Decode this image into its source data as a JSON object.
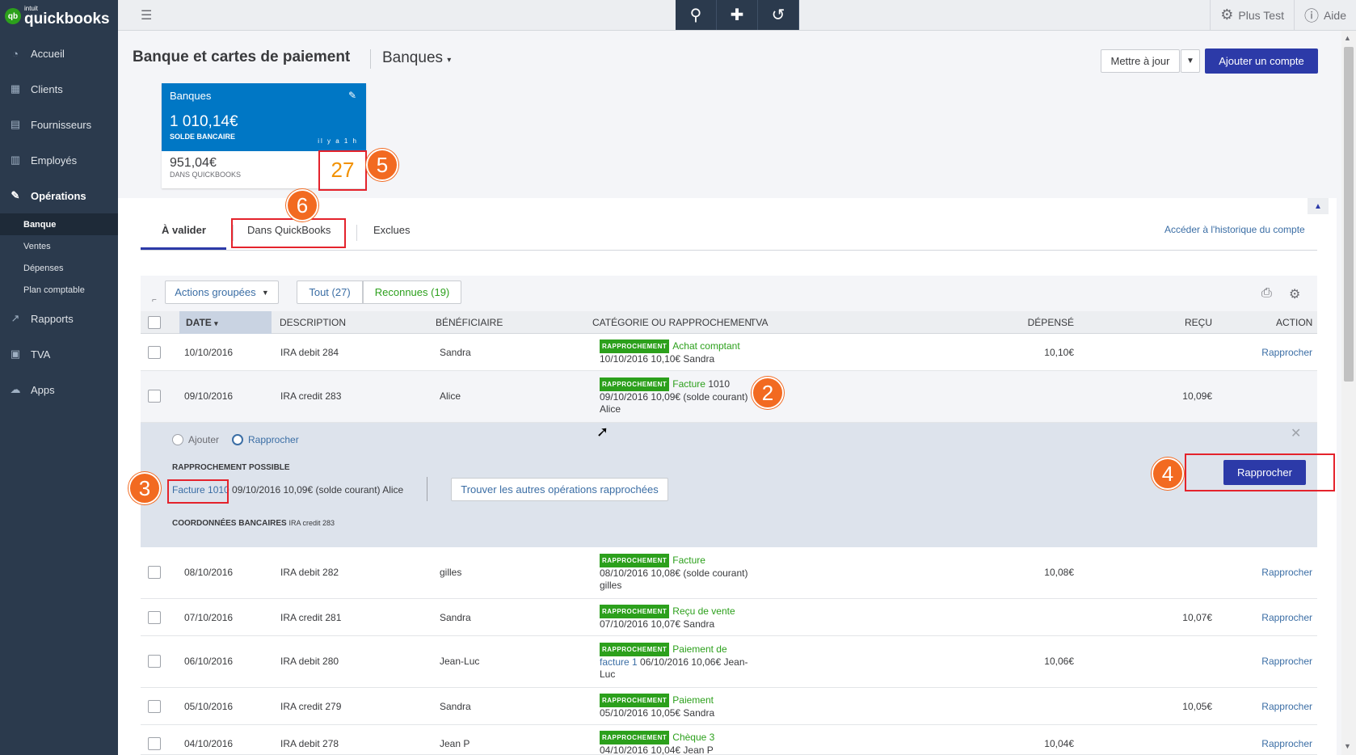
{
  "brand": {
    "small": "intuit",
    "name": "quickbooks",
    "mark": "qb"
  },
  "sidebar": {
    "items": [
      {
        "label": "Accueil",
        "icon": "dashboard-icon"
      },
      {
        "label": "Clients",
        "icon": "clients-icon"
      },
      {
        "label": "Fournisseurs",
        "icon": "vendors-icon"
      },
      {
        "label": "Employés",
        "icon": "employees-icon"
      },
      {
        "label": "Opérations",
        "icon": "transactions-icon"
      }
    ],
    "sub_items": [
      "Banque",
      "Ventes",
      "Dépenses",
      "Plan comptable"
    ],
    "items_after": [
      {
        "label": "Rapports",
        "icon": "reports-icon"
      },
      {
        "label": "TVA",
        "icon": "tax-icon"
      },
      {
        "label": "Apps",
        "icon": "apps-icon"
      }
    ]
  },
  "topbar": {
    "settings_label": "Plus Test",
    "help_label": "Aide"
  },
  "header": {
    "title": "Banque et cartes de paiement",
    "subtitle": "Banques",
    "update_label": "Mettre à jour",
    "add_account_label": "Ajouter un compte"
  },
  "card": {
    "name": "Banques",
    "bank_balance": "1 010,14€",
    "bank_balance_label": "SOLDE BANCAIRE",
    "ago": "il y a 1 h",
    "qb_balance": "951,04€",
    "qb_balance_label": "DANS QUICKBOOKS",
    "count": "27"
  },
  "annotations": [
    "2",
    "3",
    "4",
    "5",
    "6"
  ],
  "tabs": {
    "to_review": "À valider",
    "in_qb": "Dans QuickBooks",
    "excluded": "Exclues",
    "history_link": "Accéder à l'historique du compte"
  },
  "toolbar": {
    "batch_actions": "Actions groupées",
    "all": "Tout (27)",
    "recognized": "Reconnues (19)"
  },
  "columns": {
    "date": "DATE",
    "description": "DESCRIPTION",
    "payee": "BÉNÉFICIAIRE",
    "category": "CATÉGORIE OU RAPPROCHEMEN",
    "tva": "TVA",
    "spent": "DÉPENSÉ",
    "received": "REÇU",
    "action": "ACTION"
  },
  "badge": "RAPPROCHEMENT",
  "rows": [
    {
      "date": "10/10/2016",
      "description": "IRA debit 284",
      "payee": "Sandra",
      "match_title": "Achat comptant",
      "match_l1": "10/10/2016 10,10€ Sandra",
      "match_l2": "",
      "spent": "10,10€",
      "received": "",
      "action": "Rapprocher"
    },
    {
      "date": "09/10/2016",
      "description": "IRA credit 283",
      "payee": "Alice",
      "match_title": "Facture",
      "match_title_b": "1010",
      "match_l1": "09/10/2016 10,09€ (solde courant)",
      "match_l2": "Alice",
      "spent": "",
      "received": "10,09€",
      "action": ""
    },
    {
      "date": "08/10/2016",
      "description": "IRA debit 282",
      "payee": "gilles",
      "match_title": "Facture",
      "match_l1": "08/10/2016 10,08€ (solde courant)",
      "match_l2": "gilles",
      "spent": "10,08€",
      "received": "",
      "action": "Rapprocher"
    },
    {
      "date": "07/10/2016",
      "description": "IRA credit 281",
      "payee": "Sandra",
      "match_title": "Reçu de vente",
      "match_l1": "07/10/2016 10,07€ Sandra",
      "match_l2": "",
      "spent": "",
      "received": "10,07€",
      "action": "Rapprocher"
    },
    {
      "date": "06/10/2016",
      "description": "IRA debit 280",
      "payee": "Jean-Luc",
      "match_title": "Paiement de",
      "match_l1": "facture 1 06/10/2016 10,06€ Jean-",
      "match_l1_link": "facture 1",
      "match_l1_rest": " 06/10/2016 10,06€ Jean-",
      "match_l2": "Luc",
      "spent": "10,06€",
      "received": "",
      "action": "Rapprocher"
    },
    {
      "date": "05/10/2016",
      "description": "IRA credit 279",
      "payee": "Sandra",
      "match_title": "Paiement",
      "match_l1": "05/10/2016 10,05€ Sandra",
      "match_l2": "",
      "spent": "",
      "received": "10,05€",
      "action": "Rapprocher"
    },
    {
      "date": "04/10/2016",
      "description": "IRA debit 278",
      "payee": "Jean P",
      "match_title": "Chèque 3",
      "match_l1": "04/10/2016 10,04€ Jean P",
      "match_l2": "",
      "spent": "10,04€",
      "received": "",
      "action": "Rapprocher"
    }
  ],
  "expanded": {
    "add_label": "Ajouter",
    "match_label": "Rapprocher",
    "possible_title": "RAPPROCHEMENT POSSIBLE",
    "match_link": "Facture 1010",
    "match_detail": " 09/10/2016 10,09€ (solde courant) Alice",
    "find_others": "Trouver les autres opérations rapprochées",
    "bank_details_title": "COORDONNÉES BANCAIRES",
    "bank_details_value": "IRA credit 283",
    "match_button": "Rapprocher"
  },
  "colors": {
    "sidebar": "#2b3a4d",
    "accent": "#2c3aa8",
    "bank_card": "#0077c5",
    "badge": "#2ca01c",
    "annotation": "#f26a21",
    "annotation_box": "#e4232c",
    "count": "#f29100"
  }
}
